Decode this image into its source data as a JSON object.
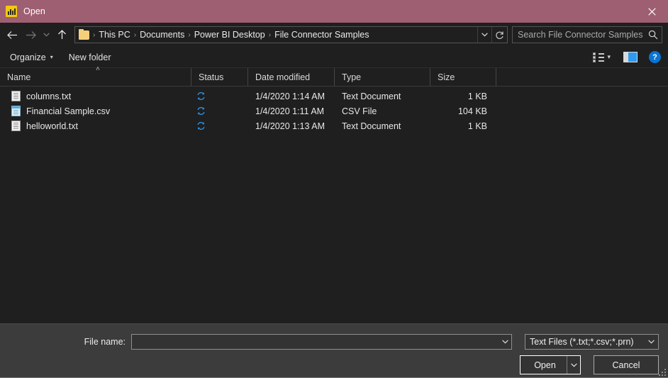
{
  "titlebar": {
    "title": "Open",
    "app_icon": "power-bi-icon",
    "close_label": "✕",
    "bg_color": "#9e5f72"
  },
  "navbar": {
    "back_icon": "arrow-left-icon",
    "forward_icon": "arrow-right-icon",
    "recent_icon": "chevron-down-icon",
    "up_icon": "arrow-up-icon",
    "breadcrumb": [
      "This PC",
      "Documents",
      "Power BI Desktop",
      "File Connector Samples"
    ],
    "breadcrumb_separator": "›",
    "address_chevron": "chevron-down-icon",
    "refresh_icon": "refresh-icon",
    "search": {
      "placeholder": "Search File Connector Samples",
      "value": "",
      "icon": "search-icon"
    }
  },
  "commandbar": {
    "organize_label": "Organize",
    "organize_caret": "▾",
    "new_folder_label": "New folder",
    "view_icon": "view-options-icon",
    "view_caret": "▾",
    "preview_pane_icon": "preview-pane-icon",
    "help_icon": "help-icon",
    "help_label": "?"
  },
  "columns": [
    {
      "label": "Name",
      "key": "name"
    },
    {
      "label": "Status",
      "key": "status"
    },
    {
      "label": "Date modified",
      "key": "date"
    },
    {
      "label": "Type",
      "key": "type"
    },
    {
      "label": "Size",
      "key": "size"
    }
  ],
  "sort": {
    "column": "Name",
    "direction": "ascending",
    "glyph": "˄"
  },
  "files": [
    {
      "name": "columns.txt",
      "icon": "text-file-icon",
      "status_icon": "sync-pending-icon",
      "date": "1/4/2020 1:14 AM",
      "type": "Text Document",
      "size": "1 KB"
    },
    {
      "name": "Financial Sample.csv",
      "icon": "csv-file-icon",
      "status_icon": "sync-pending-icon",
      "date": "1/4/2020 1:11 AM",
      "type": "CSV File",
      "size": "104 KB"
    },
    {
      "name": "helloworld.txt",
      "icon": "text-file-icon",
      "status_icon": "sync-pending-icon",
      "date": "1/4/2020 1:13 AM",
      "type": "Text Document",
      "size": "1 KB"
    }
  ],
  "footer": {
    "filename_label": "File name:",
    "filename_value": "",
    "filename_placeholder": "",
    "filter_value": "Text Files (*.txt;*.csv;*.prn)",
    "open_label": "Open",
    "open_split_caret": "▾",
    "cancel_label": "Cancel"
  },
  "colors": {
    "accent": "#9e5f72",
    "body_bg": "#1f1f1f",
    "footer_bg": "#3c3c3c",
    "sync_blue": "#2a8fe0",
    "help_blue": "#0a74d3",
    "folder_yellow": "#f5cf7b"
  }
}
